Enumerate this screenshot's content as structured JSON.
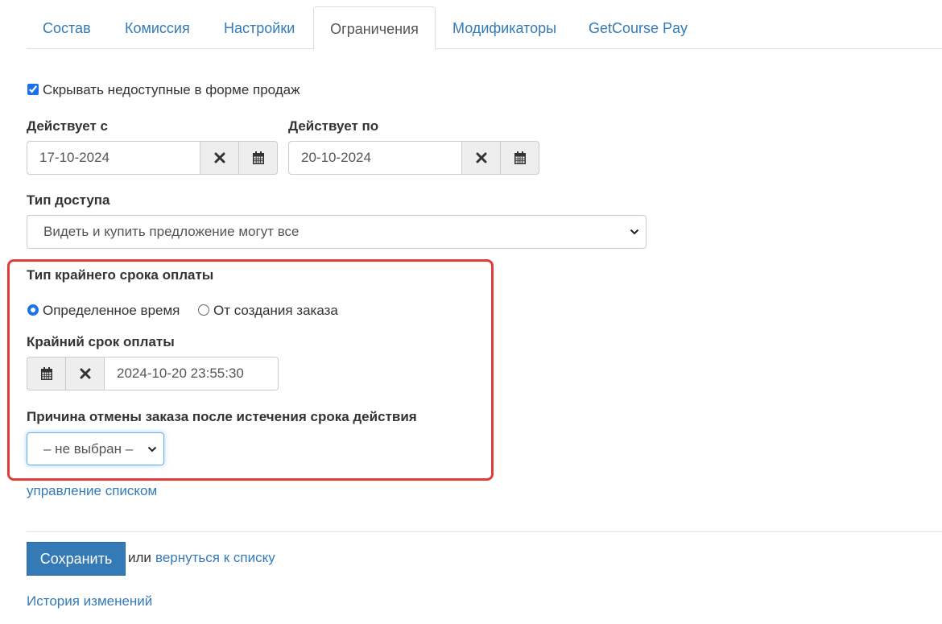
{
  "tabs": [
    {
      "label": "Состав"
    },
    {
      "label": "Комиссия"
    },
    {
      "label": "Настройки"
    },
    {
      "label": "Ограничения",
      "active": true
    },
    {
      "label": "Модификаторы"
    },
    {
      "label": "GetCourse Pay"
    }
  ],
  "hide_unavailable": {
    "label": "Скрывать недоступные в форме продаж",
    "checked": true
  },
  "valid_from": {
    "label": "Действует с",
    "value": "17-10-2024"
  },
  "valid_to": {
    "label": "Действует по",
    "value": "20-10-2024"
  },
  "access_type": {
    "label": "Тип доступа",
    "selected": "Видеть и купить предложение могут все"
  },
  "deadline_type": {
    "label": "Тип крайнего срока оплаты",
    "options": [
      {
        "label": "Определенное время",
        "selected": true
      },
      {
        "label": "От создания заказа",
        "selected": false
      }
    ]
  },
  "deadline": {
    "label": "Крайний срок оплаты",
    "value": "2024-10-20 23:55:30"
  },
  "cancel_reason": {
    "label": "Причина отмены заказа после истечения срока действия",
    "selected": "– не выбран –"
  },
  "manage_list_link": "управление списком",
  "footer": {
    "save_label": "Сохранить",
    "or_text": "или",
    "back_link": "вернуться к списку",
    "history_link": "История изменений"
  },
  "colors": {
    "accent": "#337ab7",
    "highlight_border": "#e03c3c",
    "radio_checked": "#1a73e8"
  },
  "icons": {
    "clear": "times-icon",
    "calendar": "calendar-icon",
    "dropdown": "chevron-down-icon"
  }
}
